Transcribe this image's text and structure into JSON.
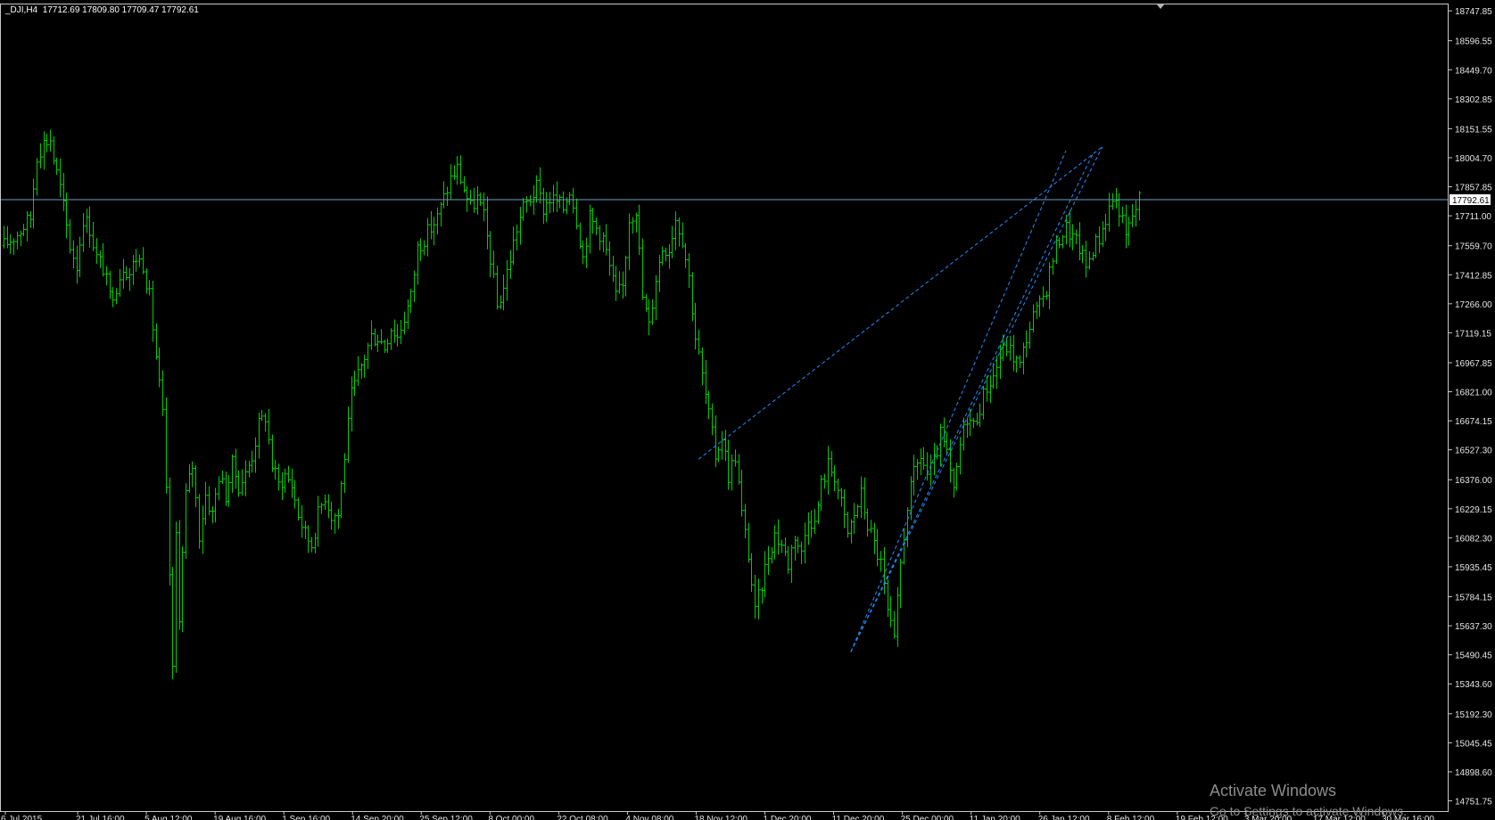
{
  "header": {
    "symbol": "_DJI,H4",
    "ohlc": "17712.69 17809.80 17709.47 17792.61"
  },
  "watermark": {
    "title": "Activate Windows",
    "subtitle": "Go to Settings to activate Windows."
  },
  "colors": {
    "background": "#000000",
    "bars": "#00cc00",
    "grid_border": "#c8c8c8",
    "current_price_line": "#6f9fc0",
    "trendlines": "#1e90ff",
    "axis_text": "#e6e6e6"
  },
  "chart_data": {
    "type": "ohlc-bar",
    "title": "",
    "symbol": "_DJI",
    "timeframe": "H4",
    "current_price": 17792.61,
    "current_price_label": "17792.61",
    "ylim": [
      14700,
      18780
    ],
    "y_ticks": [
      "18747.85",
      "18596.55",
      "18449.70",
      "18302.85",
      "18151.55",
      "18004.70",
      "17857.85",
      "17711.00",
      "17559.70",
      "17412.85",
      "17266.00",
      "17119.15",
      "16967.85",
      "16821.00",
      "16674.15",
      "16527.30",
      "16376.00",
      "16229.15",
      "16082.30",
      "15935.45",
      "15784.15",
      "15637.30",
      "15490.45",
      "15343.60",
      "15192.30",
      "15045.45",
      "14898.60",
      "14751.75"
    ],
    "x_ticks": [
      "6 Jul 2015",
      "21 Jul 16:00",
      "5 Aug 12:00",
      "19 Aug 16:00",
      "1 Sep 16:00",
      "14 Sep 20:00",
      "25 Sep 12:00",
      "8 Oct 00:00",
      "22 Oct 08:00",
      "4 Nov 08:00",
      "18 Nov 12:00",
      "1 Dec 20:00",
      "11 Dec 20:00",
      "25 Dec 00:00",
      "11 Jan 20:00",
      "26 Jan 12:00",
      "8 Feb 12:00",
      "19 Feb 12:00",
      "3 Mar 20:00",
      "17 Mar 12:00",
      "30 Mar 16:00"
    ],
    "bar_count": 406,
    "close_path": [
      [
        0,
        17560
      ],
      [
        4,
        17620
      ],
      [
        8,
        17700
      ],
      [
        10,
        18020
      ],
      [
        12,
        18080
      ],
      [
        14,
        18100
      ],
      [
        15,
        18000
      ],
      [
        17,
        17850
      ],
      [
        20,
        17560
      ],
      [
        22,
        17460
      ],
      [
        24,
        17700
      ],
      [
        26,
        17650
      ],
      [
        28,
        17500
      ],
      [
        30,
        17450
      ],
      [
        32,
        17300
      ],
      [
        34,
        17360
      ],
      [
        36,
        17460
      ],
      [
        38,
        17420
      ],
      [
        40,
        17500
      ],
      [
        42,
        17470
      ],
      [
        44,
        17300
      ],
      [
        46,
        17000
      ],
      [
        48,
        16700
      ],
      [
        50,
        15900
      ],
      [
        51,
        15400
      ],
      [
        52,
        16100
      ],
      [
        53,
        15700
      ],
      [
        55,
        16300
      ],
      [
        57,
        16450
      ],
      [
        59,
        16100
      ],
      [
        61,
        16300
      ],
      [
        63,
        16200
      ],
      [
        65,
        16400
      ],
      [
        67,
        16300
      ],
      [
        69,
        16450
      ],
      [
        71,
        16350
      ],
      [
        73,
        16400
      ],
      [
        75,
        16500
      ],
      [
        77,
        16650
      ],
      [
        79,
        16700
      ],
      [
        81,
        16450
      ],
      [
        83,
        16350
      ],
      [
        85,
        16400
      ],
      [
        87,
        16350
      ],
      [
        89,
        16200
      ],
      [
        91,
        16100
      ],
      [
        93,
        16050
      ],
      [
        95,
        16200
      ],
      [
        97,
        16300
      ],
      [
        99,
        16200
      ],
      [
        101,
        16200
      ],
      [
        103,
        16500
      ],
      [
        105,
        16800
      ],
      [
        107,
        16900
      ],
      [
        109,
        17000
      ],
      [
        111,
        17100
      ],
      [
        113,
        17100
      ],
      [
        115,
        17050
      ],
      [
        117,
        17150
      ],
      [
        119,
        17100
      ],
      [
        121,
        17200
      ],
      [
        123,
        17300
      ],
      [
        125,
        17550
      ],
      [
        127,
        17600
      ],
      [
        129,
        17650
      ],
      [
        131,
        17700
      ],
      [
        133,
        17800
      ],
      [
        135,
        17900
      ],
      [
        137,
        17950
      ],
      [
        139,
        17850
      ],
      [
        141,
        17750
      ],
      [
        143,
        17800
      ],
      [
        145,
        17700
      ],
      [
        147,
        17500
      ],
      [
        149,
        17250
      ],
      [
        151,
        17350
      ],
      [
        153,
        17500
      ],
      [
        155,
        17650
      ],
      [
        157,
        17750
      ],
      [
        159,
        17800
      ],
      [
        161,
        17850
      ],
      [
        163,
        17750
      ],
      [
        165,
        17800
      ],
      [
        167,
        17780
      ],
      [
        169,
        17750
      ],
      [
        171,
        17850
      ],
      [
        173,
        17700
      ],
      [
        175,
        17500
      ],
      [
        177,
        17700
      ],
      [
        179,
        17650
      ],
      [
        181,
        17600
      ],
      [
        183,
        17450
      ],
      [
        185,
        17300
      ],
      [
        187,
        17350
      ],
      [
        189,
        17700
      ],
      [
        191,
        17750
      ],
      [
        193,
        17300
      ],
      [
        195,
        17150
      ],
      [
        197,
        17400
      ],
      [
        199,
        17550
      ],
      [
        201,
        17550
      ],
      [
        203,
        17700
      ],
      [
        205,
        17600
      ],
      [
        207,
        17400
      ],
      [
        209,
        17100
      ],
      [
        211,
        16900
      ],
      [
        213,
        16700
      ],
      [
        215,
        16500
      ],
      [
        217,
        16600
      ],
      [
        219,
        16400
      ],
      [
        221,
        16500
      ],
      [
        223,
        16200
      ],
      [
        225,
        16000
      ],
      [
        227,
        15700
      ],
      [
        229,
        15850
      ],
      [
        231,
        16000
      ],
      [
        233,
        16100
      ],
      [
        235,
        16050
      ],
      [
        237,
        15950
      ],
      [
        239,
        16100
      ],
      [
        241,
        16000
      ],
      [
        243,
        16200
      ],
      [
        245,
        16150
      ],
      [
        247,
        16350
      ],
      [
        249,
        16450
      ],
      [
        251,
        16400
      ],
      [
        253,
        16250
      ],
      [
        255,
        16100
      ],
      [
        257,
        16200
      ],
      [
        259,
        16300
      ],
      [
        261,
        16150
      ],
      [
        263,
        16050
      ],
      [
        265,
        15950
      ],
      [
        267,
        15700
      ],
      [
        269,
        15550
      ],
      [
        271,
        15950
      ],
      [
        273,
        16250
      ],
      [
        275,
        16400
      ],
      [
        277,
        16500
      ],
      [
        279,
        16400
      ],
      [
        281,
        16450
      ],
      [
        283,
        16600
      ],
      [
        285,
        16500
      ],
      [
        287,
        16300
      ],
      [
        289,
        16550
      ],
      [
        291,
        16700
      ],
      [
        293,
        16650
      ],
      [
        295,
        16750
      ],
      [
        297,
        16850
      ],
      [
        299,
        16900
      ],
      [
        301,
        17000
      ],
      [
        303,
        17050
      ],
      [
        305,
        17000
      ],
      [
        307,
        16950
      ],
      [
        309,
        17100
      ],
      [
        311,
        17200
      ],
      [
        313,
        17250
      ],
      [
        315,
        17350
      ],
      [
        317,
        17500
      ],
      [
        319,
        17600
      ],
      [
        321,
        17650
      ],
      [
        323,
        17600
      ],
      [
        325,
        17550
      ],
      [
        327,
        17450
      ],
      [
        329,
        17550
      ],
      [
        331,
        17600
      ],
      [
        333,
        17700
      ],
      [
        335,
        17800
      ],
      [
        337,
        17750
      ],
      [
        339,
        17600
      ],
      [
        341,
        17710
      ],
      [
        343,
        17792
      ]
    ],
    "trendlines": [
      {
        "from": {
          "bar": 210,
          "price": 16480
        },
        "to": {
          "bar": 332,
          "price": 18060
        }
      },
      {
        "from": {
          "bar": 256,
          "price": 15505
        },
        "to": {
          "bar": 332,
          "price": 18060
        }
      },
      {
        "from": {
          "bar": 256,
          "price": 15505
        },
        "to": {
          "bar": 321,
          "price": 18040
        }
      },
      {
        "from": {
          "bar": 256,
          "price": 15505
        },
        "to": {
          "bar": 329,
          "price": 18020
        }
      }
    ]
  }
}
